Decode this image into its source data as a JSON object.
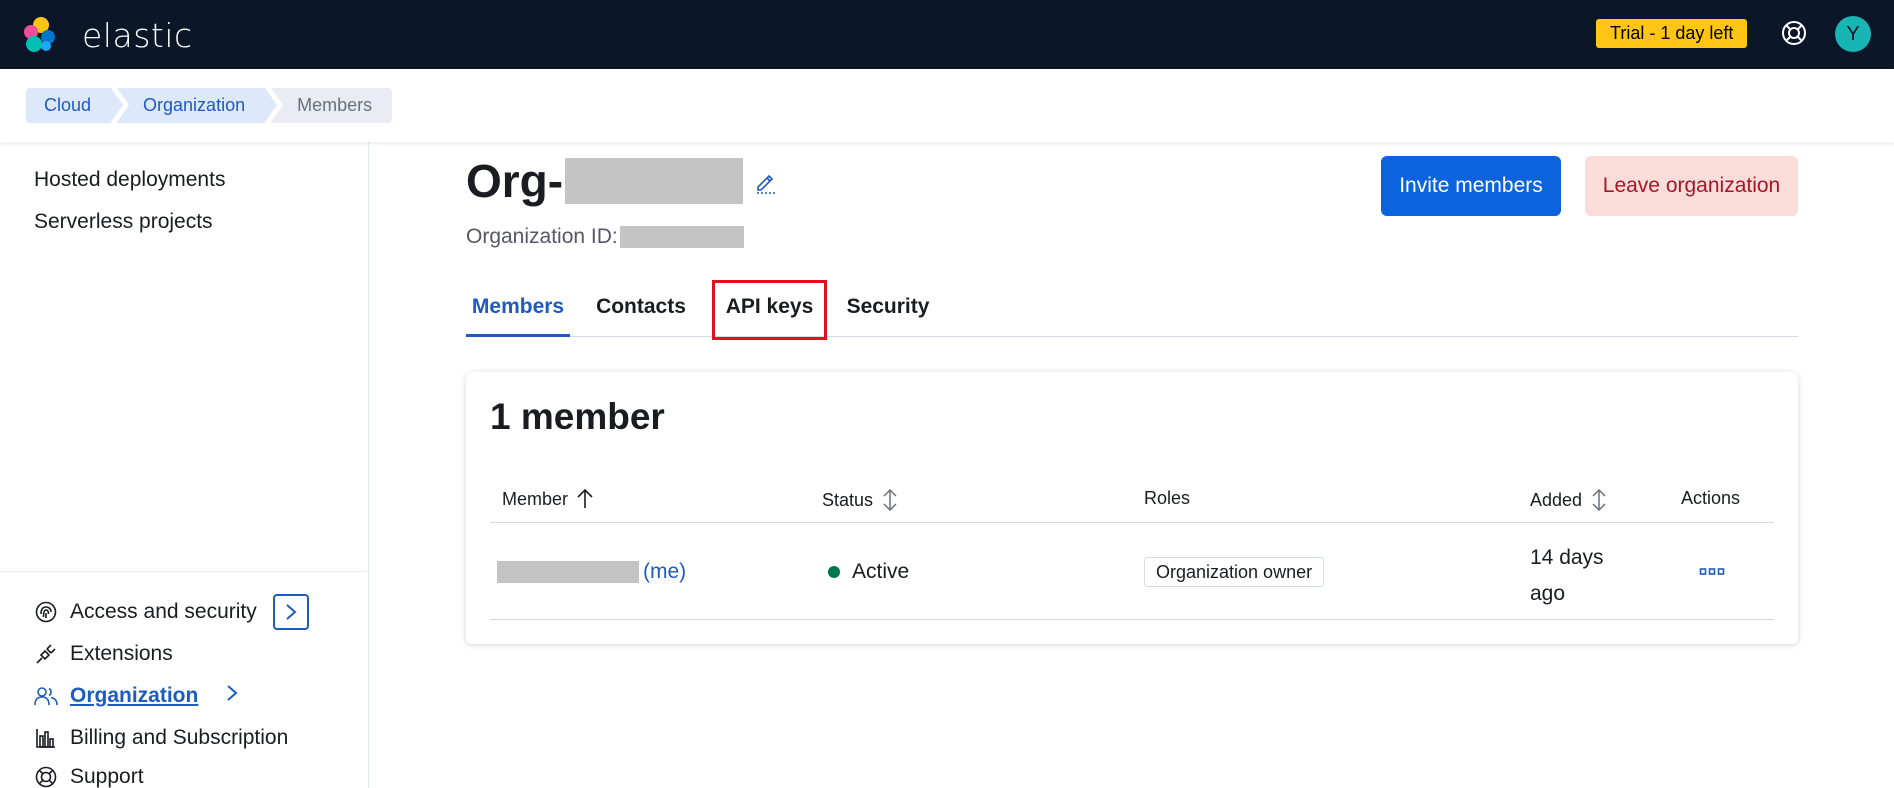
{
  "header": {
    "brand": "elastic",
    "trial_badge": "Trial - 1 day left",
    "avatar_initial": "Y"
  },
  "breadcrumbs": [
    "Cloud",
    "Organization",
    "Members"
  ],
  "sidebar": {
    "top_items": [
      "Hosted deployments",
      "Serverless projects"
    ],
    "bottom_items": [
      {
        "label": "Access and security",
        "icon": "fingerprint-icon"
      },
      {
        "label": "Extensions",
        "icon": "plug-icon"
      },
      {
        "label": "Organization",
        "icon": "users-icon",
        "active": true
      },
      {
        "label": "Billing and Subscription",
        "icon": "bar-chart-icon"
      },
      {
        "label": "Support",
        "icon": "lifebuoy-icon"
      }
    ]
  },
  "main": {
    "org_title_prefix": "Org-",
    "org_id_label": "Organization ID:",
    "invite_button": "Invite members",
    "leave_button": "Leave organization",
    "tabs": [
      "Members",
      "Contacts",
      "API keys",
      "Security"
    ],
    "selected_tab": "Members",
    "highlighted_tab": "API keys"
  },
  "members_panel": {
    "title": "1 member",
    "columns": {
      "member": "Member",
      "status": "Status",
      "roles": "Roles",
      "added": "Added",
      "actions": "Actions"
    },
    "rows": [
      {
        "me_suffix": "(me)",
        "status": "Active",
        "role": "Organization owner",
        "added": "14 days ago"
      }
    ]
  },
  "colors": {
    "header_bg": "#0b1628",
    "accent": "#0b64dd",
    "link": "#1d5bbf",
    "trial_badge": "#fec514",
    "danger_bg": "#fadcd9",
    "danger_text": "#a71627",
    "status_active": "#00774a",
    "highlight_outline": "#e0101e"
  }
}
